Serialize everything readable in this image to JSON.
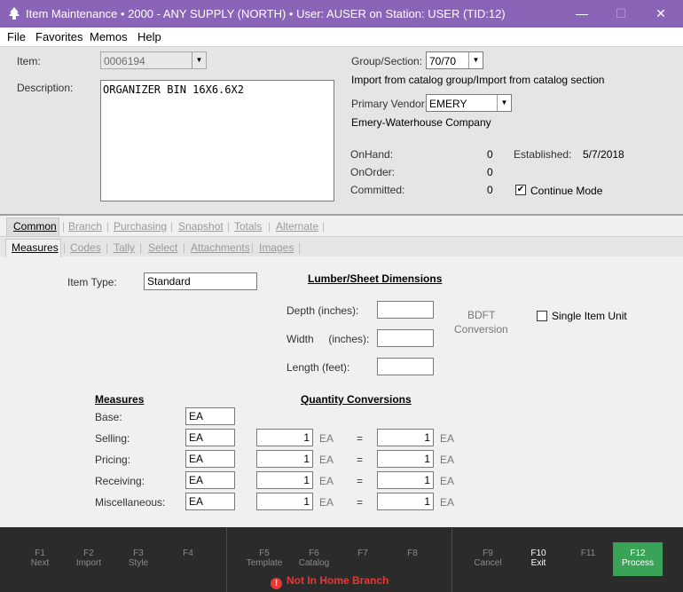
{
  "window": {
    "title": "Item Maintenance  •  2000 - ANY SUPPLY (NORTH)  •  User: AUSER on Station: USER (TID:12)"
  },
  "menu": [
    "File",
    "Favorites",
    "Memos",
    "Help"
  ],
  "header": {
    "item_label": "Item:",
    "item_value": "0006194",
    "description_label": "Description:",
    "description_value": "ORGANIZER BIN 16X6.6X2",
    "group_label": "Group/Section:",
    "group_value": "70/70",
    "import_text": "Import from catalog group/Import from catalog section",
    "vendor_label": "Primary Vendor:",
    "vendor_value": "EMERY",
    "vendor_name": "Emery-Waterhouse Company",
    "onhand_label": "OnHand:",
    "onhand_value": "0",
    "onorder_label": "OnOrder:",
    "onorder_value": "0",
    "committed_label": "Committed:",
    "committed_value": "0",
    "established_label": "Established:",
    "established_value": "5/7/2018",
    "continue_label": "Continue Mode",
    "continue_checked": true
  },
  "tabs_main": [
    "Common",
    "Branch",
    "Purchasing",
    "Snapshot",
    "Totals",
    "Alternate"
  ],
  "tabs_sub": [
    "Measures",
    "Codes",
    "Tally",
    "Select",
    "Attachments",
    "Images"
  ],
  "content": {
    "item_type_label": "Item Type:",
    "item_type_value": "Standard",
    "lumber_header": "Lumber/Sheet Dimensions",
    "depth_label": "Depth (inches):",
    "width_label": "Width     (inches):",
    "length_label": "Length (feet):",
    "bdft_label": "BDFT",
    "conversion_label": "Conversion",
    "single_item_label": "Single Item Unit",
    "measures_header": "Measures",
    "qty_header": "Quantity Conversions",
    "base_label": "Base:",
    "base_value": "EA",
    "rows": [
      {
        "label": "Selling:",
        "unit": "EA",
        "qty": "1",
        "qty_unit": "EA",
        "eq": "=",
        "qty2": "1",
        "qty2_unit": "EA"
      },
      {
        "label": "Pricing:",
        "unit": "EA",
        "qty": "1",
        "qty_unit": "EA",
        "eq": "=",
        "qty2": "1",
        "qty2_unit": "EA"
      },
      {
        "label": "Receiving:",
        "unit": "EA",
        "qty": "1",
        "qty_unit": "EA",
        "eq": "=",
        "qty2": "1",
        "qty2_unit": "EA"
      },
      {
        "label": "Miscellaneous:",
        "unit": "EA",
        "qty": "1",
        "qty_unit": "EA",
        "eq": "=",
        "qty2": "1",
        "qty2_unit": "EA"
      }
    ]
  },
  "fkeys": [
    {
      "key": "F1",
      "label": "Next"
    },
    {
      "key": "F2",
      "label": "Import"
    },
    {
      "key": "F3",
      "label": "Style"
    },
    {
      "key": "F4",
      "label": ""
    },
    {
      "key": "F5",
      "label": "Template"
    },
    {
      "key": "F6",
      "label": "Catalog"
    },
    {
      "key": "F7",
      "label": ""
    },
    {
      "key": "F8",
      "label": ""
    },
    {
      "key": "F9",
      "label": "Cancel"
    },
    {
      "key": "F10",
      "label": "Exit"
    },
    {
      "key": "F11",
      "label": ""
    },
    {
      "key": "F12",
      "label": "Process"
    }
  ],
  "warning": "Not In Home Branch",
  "colors": {
    "titlebar": "#8a64b7",
    "process": "#3aa357",
    "warning": "#e53935",
    "fbar": "#2b2b2b"
  }
}
